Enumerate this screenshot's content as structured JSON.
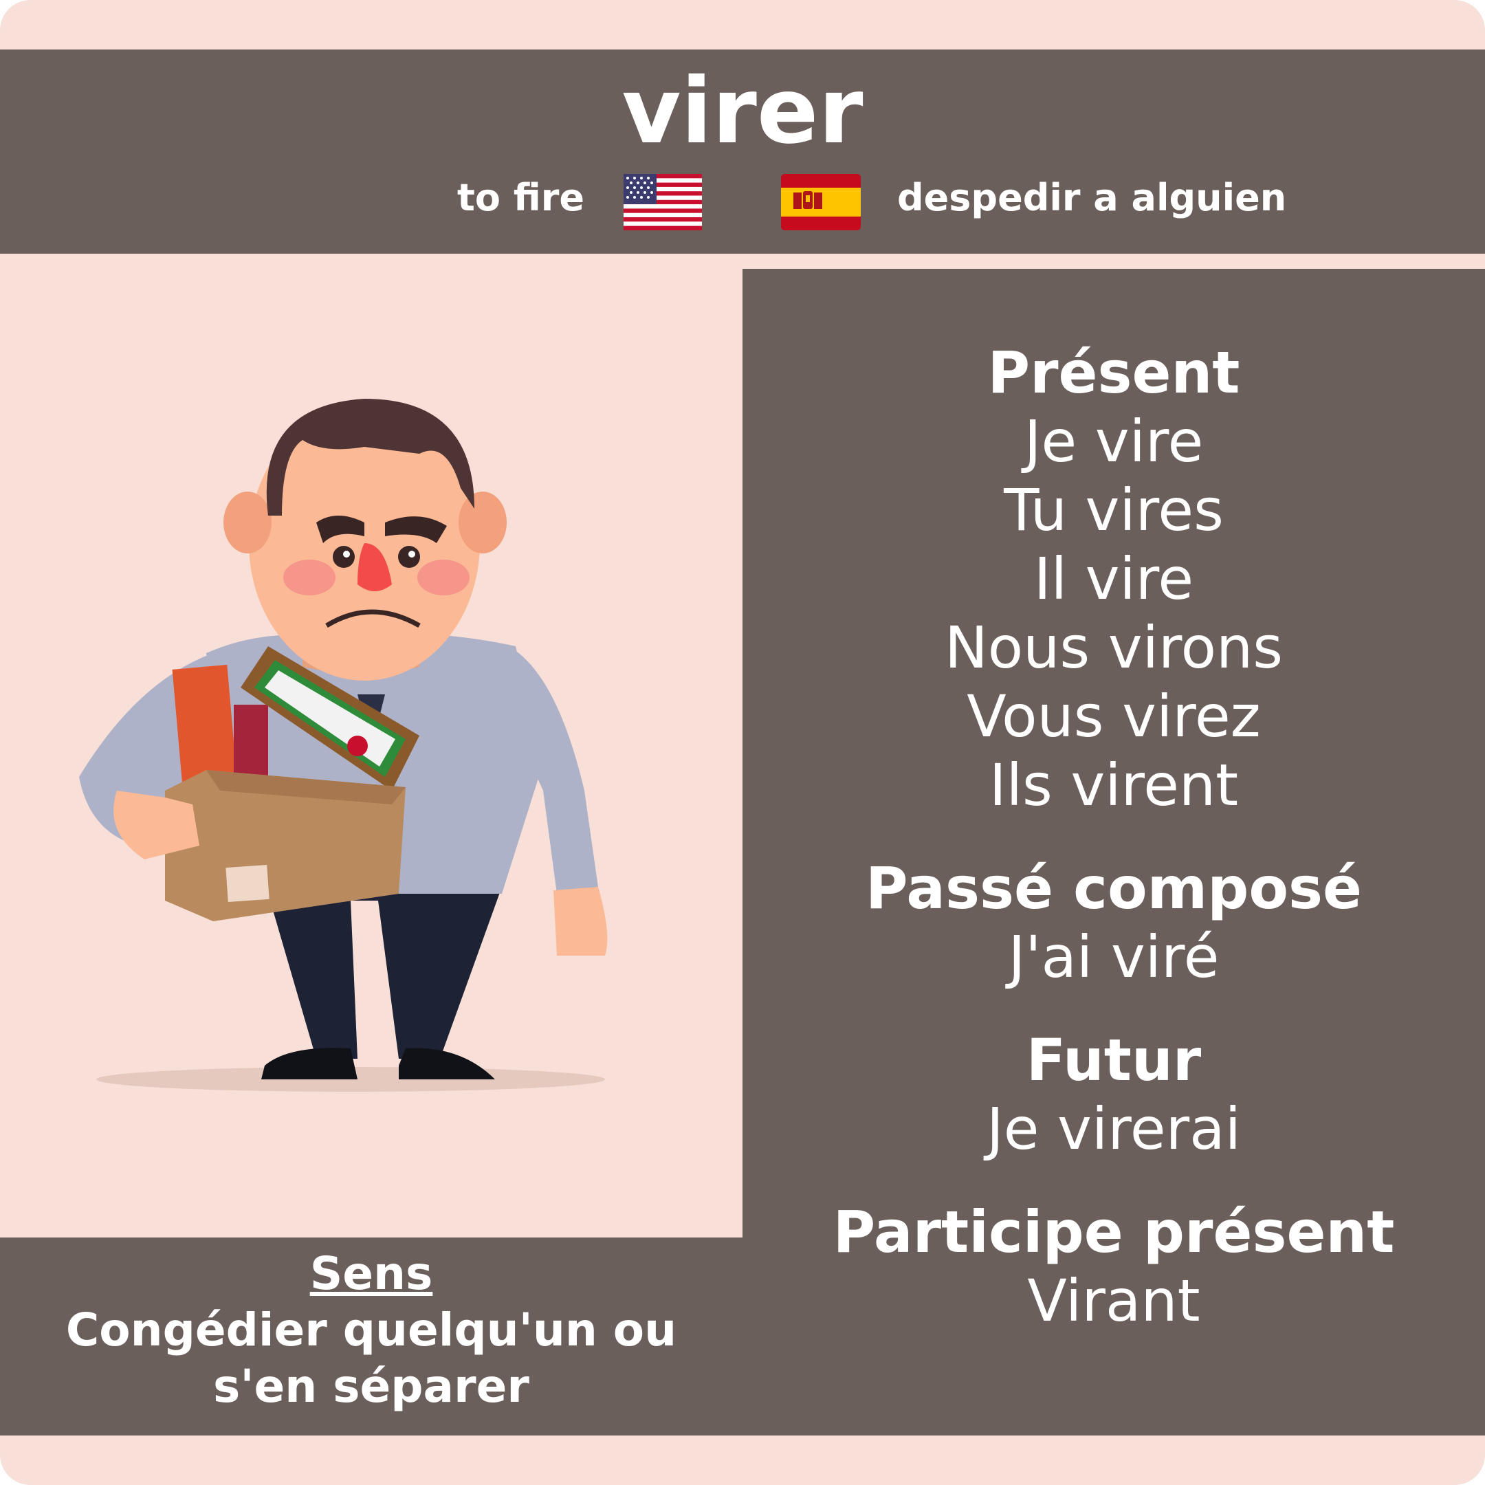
{
  "verb": "virer",
  "translations": {
    "english": "to fire",
    "spanish": "despedir a alguien",
    "english_flag_icon": "us-flag-icon",
    "spanish_flag_icon": "spain-flag-icon"
  },
  "conjugation": {
    "present": {
      "title": "Présent",
      "forms": [
        "Je vire",
        "Tu vires",
        "Il vire",
        "Nous virons",
        "Vous virez",
        "Ils virent"
      ]
    },
    "passe_compose": {
      "title": "Passé composé",
      "form": "J'ai viré"
    },
    "futur": {
      "title": "Futur",
      "form": "Je virerai"
    },
    "participe_present": {
      "title": "Participe présent",
      "form": "Virant"
    }
  },
  "meaning": {
    "title": "Sens",
    "text": "Congédier quelqu'un ou s'en séparer"
  },
  "colors": {
    "background": "#f8e0d8",
    "panel": "#6a5f5a",
    "text": "#ffffff"
  }
}
